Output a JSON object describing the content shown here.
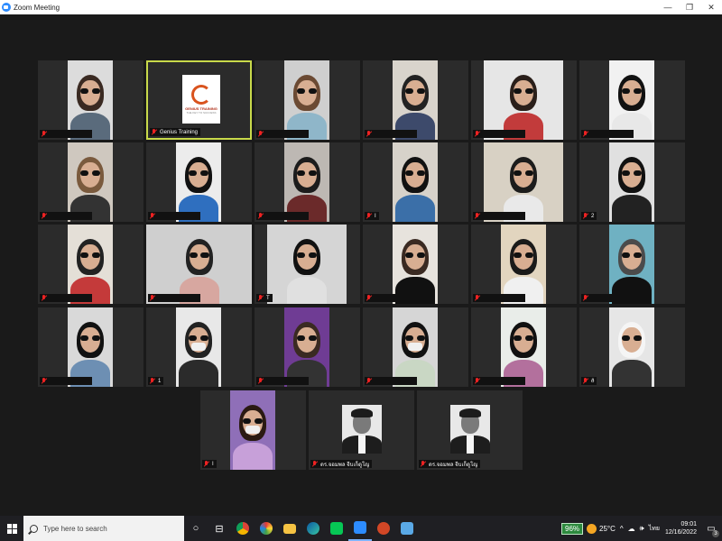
{
  "window": {
    "title": "Zoom Meeting",
    "controls": {
      "minimize": "—",
      "maximize": "❐",
      "close": "✕"
    }
  },
  "colors": {
    "active_speaker_border": "#c8d94a",
    "mute_red": "#e22222",
    "zoom_blue": "#2d8cff",
    "battery_green": "#2d8a3e"
  },
  "participants": [
    {
      "id": "p01",
      "name": "",
      "kind": "video"
    },
    {
      "id": "p02",
      "name": "Genius Training",
      "kind": "logo",
      "active": true,
      "logo_title": "GENIUS TRAINING",
      "logo_subtitle": "THE KEY TO SUCCESS"
    },
    {
      "id": "p03",
      "name": "",
      "kind": "video"
    },
    {
      "id": "p04",
      "name": "",
      "kind": "video"
    },
    {
      "id": "p05",
      "name": "",
      "kind": "video"
    },
    {
      "id": "p06",
      "name": "",
      "kind": "video"
    },
    {
      "id": "p07",
      "name": "",
      "kind": "video"
    },
    {
      "id": "p08",
      "name": "",
      "kind": "video"
    },
    {
      "id": "p09",
      "name": "",
      "kind": "video"
    },
    {
      "id": "p10",
      "name": "I",
      "kind": "video"
    },
    {
      "id": "p11",
      "name": "",
      "kind": "video"
    },
    {
      "id": "p12",
      "name": "2",
      "kind": "video"
    },
    {
      "id": "p13",
      "name": "",
      "kind": "video"
    },
    {
      "id": "p14",
      "name": "",
      "kind": "video"
    },
    {
      "id": "p15",
      "name": "T",
      "kind": "video"
    },
    {
      "id": "p16",
      "name": "",
      "kind": "video"
    },
    {
      "id": "p17",
      "name": "",
      "kind": "video"
    },
    {
      "id": "p18",
      "name": "",
      "kind": "video"
    },
    {
      "id": "p19",
      "name": "",
      "kind": "video"
    },
    {
      "id": "p20",
      "name": "1",
      "kind": "video"
    },
    {
      "id": "p21",
      "name": "",
      "kind": "video"
    },
    {
      "id": "p22",
      "name": "",
      "kind": "video"
    },
    {
      "id": "p23",
      "name": "",
      "kind": "video"
    },
    {
      "id": "p24",
      "name": "ð",
      "kind": "video"
    },
    {
      "id": "p25",
      "name": "I",
      "kind": "video"
    },
    {
      "id": "p26",
      "name": "ดร.จอมพล จีบเก็ดูโญ",
      "kind": "headshot"
    },
    {
      "id": "p27",
      "name": "ดร.จอมพล จีบเก็ดูโญ",
      "kind": "headshot"
    }
  ],
  "taskbar": {
    "search_placeholder": "Type here to search",
    "task_view_glyph": "○",
    "widgets_glyph": "⊟",
    "battery_percent": "96%",
    "temperature": "25°C",
    "tray_chevron": "^",
    "language": "ไทย",
    "time": "09:01",
    "date": "12/16/2022",
    "notification_count": "3",
    "notification_glyph": "▭"
  }
}
